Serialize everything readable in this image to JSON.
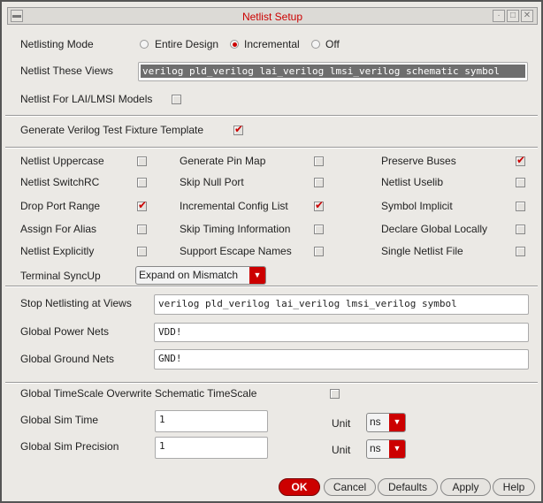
{
  "window": {
    "title": "Netlist Setup"
  },
  "mode": {
    "label": "Netlisting Mode",
    "options": [
      "Entire Design",
      "Incremental",
      "Off"
    ],
    "selected": "Incremental"
  },
  "views": {
    "label": "Netlist These Views",
    "value": "verilog pld_verilog lai_verilog lmsi_verilog schematic symbol"
  },
  "lai": {
    "label": "Netlist For LAI/LMSI Models",
    "checked": false
  },
  "fixture": {
    "label": "Generate Verilog Test Fixture Template",
    "checked": true
  },
  "options": [
    {
      "label": "Netlist Uppercase",
      "checked": false
    },
    {
      "label": "Generate Pin Map",
      "checked": false
    },
    {
      "label": "Preserve Buses",
      "checked": true
    },
    {
      "label": "Netlist SwitchRC",
      "checked": false
    },
    {
      "label": "Skip Null Port",
      "checked": false
    },
    {
      "label": "Netlist Uselib",
      "checked": false
    },
    {
      "label": "Drop Port Range",
      "checked": true
    },
    {
      "label": "Incremental Config List",
      "checked": true
    },
    {
      "label": "Symbol Implicit",
      "checked": false
    },
    {
      "label": "Assign For Alias",
      "checked": false
    },
    {
      "label": "Skip Timing Information",
      "checked": false
    },
    {
      "label": "Declare Global Locally",
      "checked": false
    },
    {
      "label": "Netlist Explicitly",
      "checked": false
    },
    {
      "label": "Support Escape Names",
      "checked": false
    },
    {
      "label": "Single Netlist File",
      "checked": false
    }
  ],
  "syncup": {
    "label": "Terminal SyncUp",
    "value": "Expand on Mismatch"
  },
  "stop": {
    "label": "Stop Netlisting at Views",
    "value": "verilog pld_verilog lai_verilog lmsi_verilog symbol"
  },
  "power": {
    "label": "Global Power Nets",
    "value": "VDD!"
  },
  "ground": {
    "label": "Global Ground Nets",
    "value": "GND!"
  },
  "timescale": {
    "label": "Global TimeScale Overwrite Schematic TimeScale",
    "checked": false
  },
  "simtime": {
    "label": "Global Sim Time",
    "value": "1",
    "unit_label": "Unit",
    "unit": "ns"
  },
  "simprec": {
    "label": "Global Sim Precision",
    "value": "1",
    "unit_label": "Unit",
    "unit": "ns"
  },
  "buttons": {
    "ok": "OK",
    "cancel": "Cancel",
    "defaults": "Defaults",
    "apply": "Apply",
    "help": "Help"
  }
}
